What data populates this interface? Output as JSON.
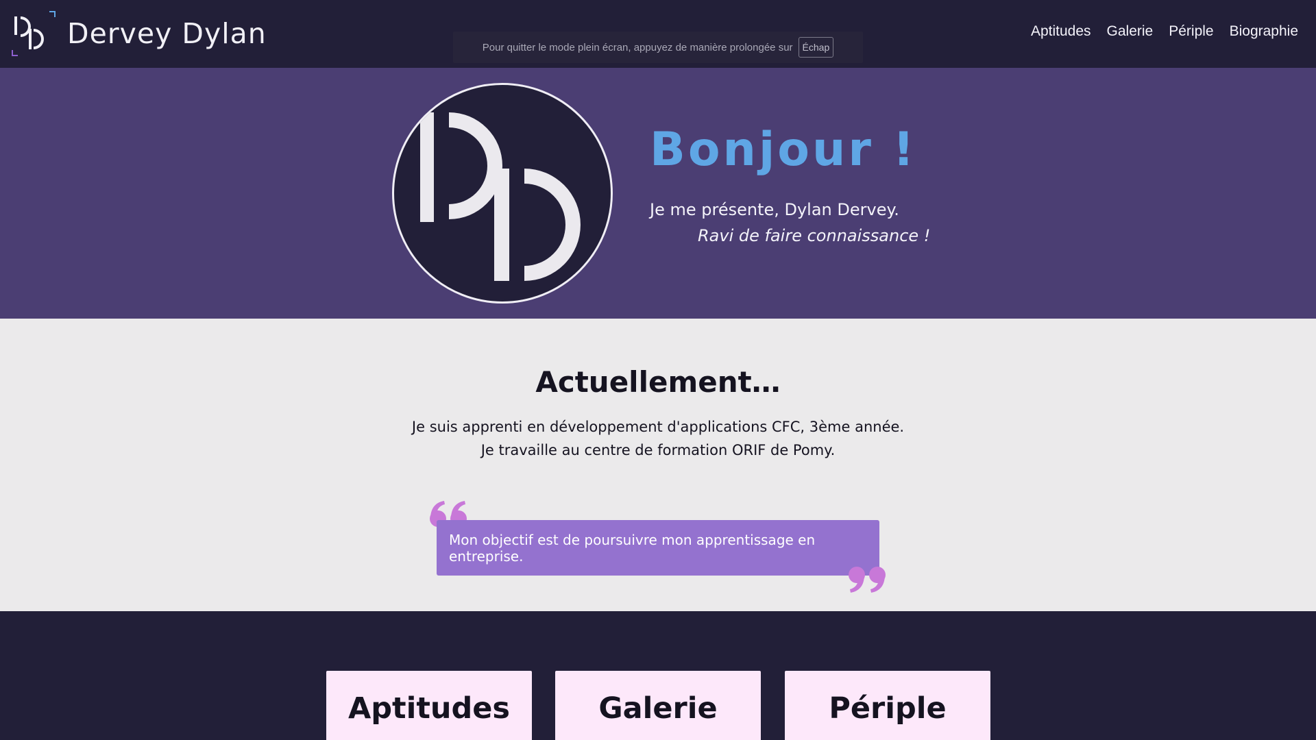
{
  "header": {
    "title": "Dervey Dylan",
    "logo_icon": "dd-monogram-icon",
    "nav": [
      {
        "label": "Aptitudes"
      },
      {
        "label": "Galerie"
      },
      {
        "label": "Périple"
      },
      {
        "label": "Biographie"
      }
    ]
  },
  "fullscreen_notice": {
    "message": "Pour quitter le mode plein écran, appuyez de manière prolongée sur",
    "key": "Échap"
  },
  "hero": {
    "greeting": "Bonjour !",
    "intro": "Je me présente, Dylan Dervey.",
    "intro_sub": "Ravi de faire connaissance !"
  },
  "current": {
    "heading": "Actuellement…",
    "line1": "Je suis apprenti en développement d'applications CFC, 3ème année.",
    "line2": "Je travaille au centre de formation ORIF de Pomy.",
    "quote": "Mon objectif est de poursuivre mon apprentissage en entreprise."
  },
  "cards": [
    {
      "label": "Aptitudes"
    },
    {
      "label": "Galerie"
    },
    {
      "label": "Périple"
    }
  ],
  "colors": {
    "dark": "#221f38",
    "hero_bg": "#4b3e73",
    "accent_blue": "#5fa6e5",
    "quote_bg": "#9472cf",
    "quote_mark": "#c878d8",
    "card_bg": "#fde8fa",
    "light_bg": "#ebeaeb"
  }
}
